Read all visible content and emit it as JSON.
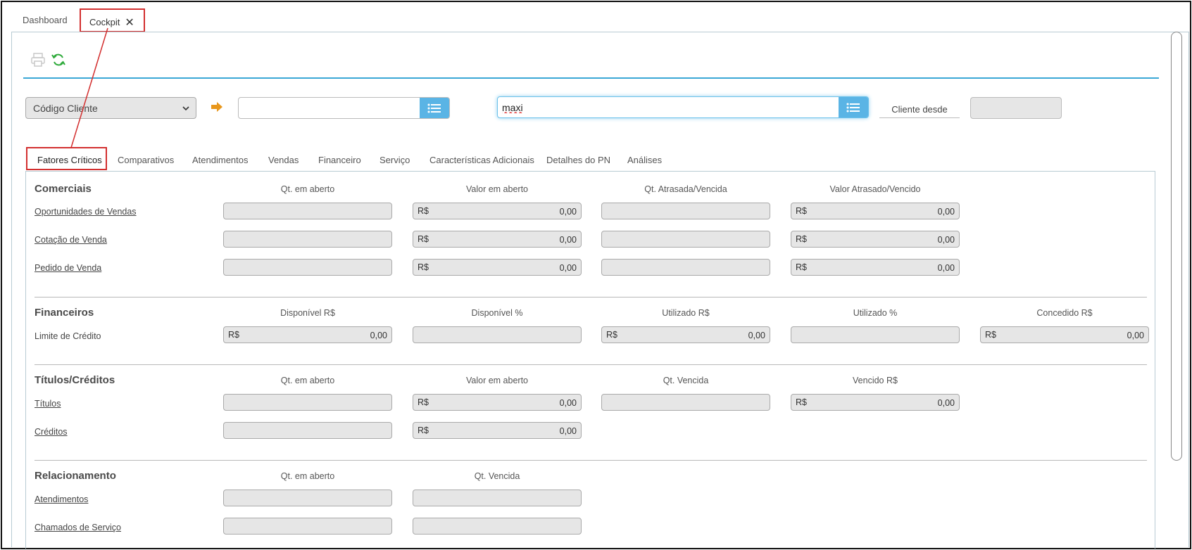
{
  "tabs": {
    "dashboard": "Dashboard",
    "cockpit": "Cockpit",
    "close": "✕"
  },
  "filter": {
    "select_value": "Código Cliente",
    "code_value": "",
    "name_value": "maxi",
    "cliente_desde_label": "Cliente desde",
    "cliente_desde_value": ""
  },
  "subtabs": [
    "Fatores Críticos",
    "Comparativos",
    "Atendimentos",
    "Vendas",
    "Financeiro",
    "Serviço",
    "Características Adicionais",
    "Detalhes do PN",
    "Análises"
  ],
  "comerciais": {
    "title": "Comerciais",
    "headers": [
      "Qt. em aberto",
      "Valor em aberto",
      "Qt. Atrasada/Vencida",
      "Valor Atrasado/Vencido"
    ],
    "rows": [
      {
        "label": "Oportunidades de Vendas",
        "currency": "R$",
        "valor": "0,00",
        "valor_atrasado": "0,00"
      },
      {
        "label": "Cotação de Venda",
        "currency": "R$",
        "valor": "0,00",
        "valor_atrasado": "0,00"
      },
      {
        "label": "Pedido de Venda",
        "currency": "R$",
        "valor": "0,00",
        "valor_atrasado": "0,00"
      }
    ]
  },
  "financeiros": {
    "title": "Financeiros",
    "headers": [
      "Disponível R$",
      "Disponível %",
      "Utilizado R$",
      "Utilizado %",
      "Concedido R$"
    ],
    "row": {
      "label": "Limite de Crédito",
      "currency": "R$",
      "disponivel": "0,00",
      "utilizado": "0,00",
      "concedido": "0,00"
    }
  },
  "titulos": {
    "title": "Títulos/Créditos",
    "headers": [
      "Qt. em aberto",
      "Valor em aberto",
      "Qt. Vencida",
      "Vencido R$"
    ],
    "rows": [
      {
        "label": "Títulos",
        "currency": "R$",
        "valor": "0,00",
        "vencido": "0,00"
      },
      {
        "label": "Créditos",
        "currency": "R$",
        "valor": "0,00"
      }
    ]
  },
  "relacionamento": {
    "title": "Relacionamento",
    "headers": [
      "Qt. em aberto",
      "Qt. Vencida"
    ],
    "rows": [
      {
        "label": "Atendimentos"
      },
      {
        "label": "Chamados de Serviço"
      }
    ]
  },
  "icons": {
    "print": "printer-icon",
    "refresh": "refresh-icon",
    "arrow": "arrow-right-icon",
    "list": "list-icon"
  },
  "colors": {
    "accent_blue": "#3aa7d6",
    "button_blue": "#5ab4e5",
    "highlight_red": "#d32f2f",
    "arrow_orange": "#e8971c",
    "refresh_green": "#2eaa3a"
  }
}
